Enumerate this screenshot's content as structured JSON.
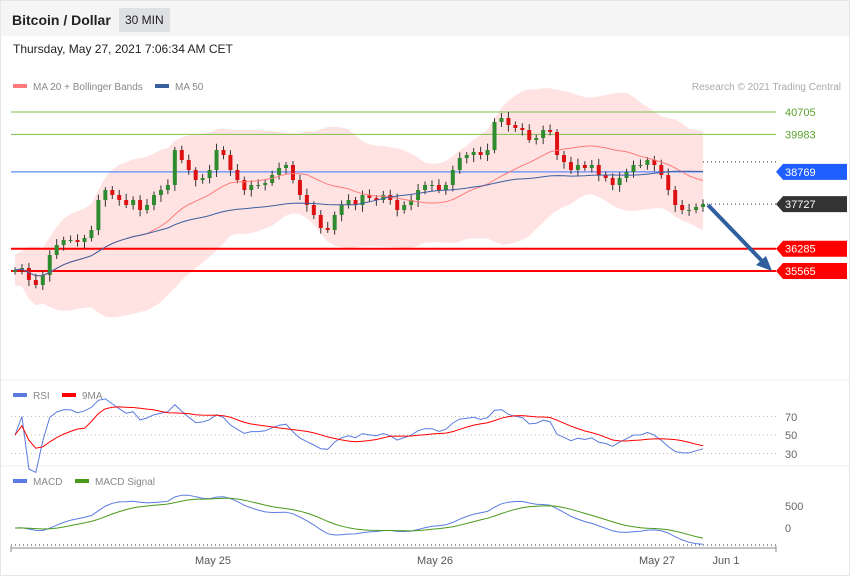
{
  "header": {
    "title": "Bitcoin / Dollar",
    "timeframe": "30 MIN",
    "date": "Thursday, May 27, 2021 7:06:34 AM CET"
  },
  "copyright": "Research © 2021 Trading Central",
  "colors": {
    "ma20": "#ff7b7b",
    "ma50": "#3a5fa0",
    "band": "#ffe3e3",
    "up": "#2e8b2e",
    "down": "#d11",
    "resistance": "#7cc04b",
    "pivot": "#1f5fff",
    "support": "#ff0000",
    "last": "#333333",
    "arrow": "#2f5f9f",
    "rsi": "#5b7be0",
    "rsi9": "#ff0000",
    "macd": "#5b7be0",
    "signal": "#4a9a1a"
  },
  "chart_data": [
    {
      "type": "candlestick",
      "title": "Bitcoin / Dollar 30 MIN",
      "legend": [
        {
          "name": "MA 20 + Bollinger Bands"
        },
        {
          "name": "MA 50"
        }
      ],
      "closes": [
        35597,
        35661,
        35273,
        35112,
        35435,
        36082,
        36405,
        36567,
        36567,
        36502,
        36631,
        36890,
        37860,
        38183,
        38022,
        37860,
        37698,
        37860,
        37537,
        37698,
        38022,
        38183,
        38345,
        39476,
        39153,
        38830,
        38506,
        38571,
        38830,
        39476,
        39314,
        38830,
        38506,
        38183,
        38345,
        38345,
        38410,
        38668,
        38895,
        38992,
        38506,
        38022,
        37698,
        37375,
        36955,
        36890,
        37375,
        37698,
        37860,
        37698,
        38022,
        37925,
        37860,
        38022,
        37860,
        37537,
        37698,
        37860,
        38183,
        38345,
        38345,
        38183,
        38345,
        38830,
        39218,
        39314,
        39412,
        39314,
        39476,
        40382,
        40511,
        40285,
        40188,
        40123,
        39800,
        39864,
        40123,
        40058,
        39314,
        39088,
        38830,
        38992,
        38895,
        38992,
        38668,
        38571,
        38345,
        38571,
        38765,
        38992,
        38992,
        39153,
        38992,
        38668,
        38183,
        37698,
        37537,
        37537,
        37634,
        37727
      ],
      "levels": [
        {
          "label": "40705",
          "value": 40705,
          "kind": "resistance"
        },
        {
          "label": "39983",
          "value": 39983,
          "kind": "resistance"
        },
        {
          "label": "38769",
          "value": 38769,
          "kind": "pivot"
        },
        {
          "label": "37727",
          "value": 37727,
          "kind": "last"
        },
        {
          "label": "36285",
          "value": 36285,
          "kind": "support"
        },
        {
          "label": "35565",
          "value": 35565,
          "kind": "support"
        }
      ],
      "x_ticks": [
        "May 25",
        "May 26",
        "May 27",
        "Jun 1"
      ]
    },
    {
      "type": "line",
      "title": "RSI",
      "legend": [
        {
          "name": "RSI"
        },
        {
          "name": "9MA"
        }
      ],
      "y_ticks": [
        "70",
        "50",
        "30"
      ],
      "ylim": [
        30,
        70
      ]
    },
    {
      "type": "line",
      "title": "MACD",
      "legend": [
        {
          "name": "MACD"
        },
        {
          "name": "MACD Signal"
        }
      ],
      "y_ticks": [
        "500",
        "0"
      ]
    }
  ]
}
